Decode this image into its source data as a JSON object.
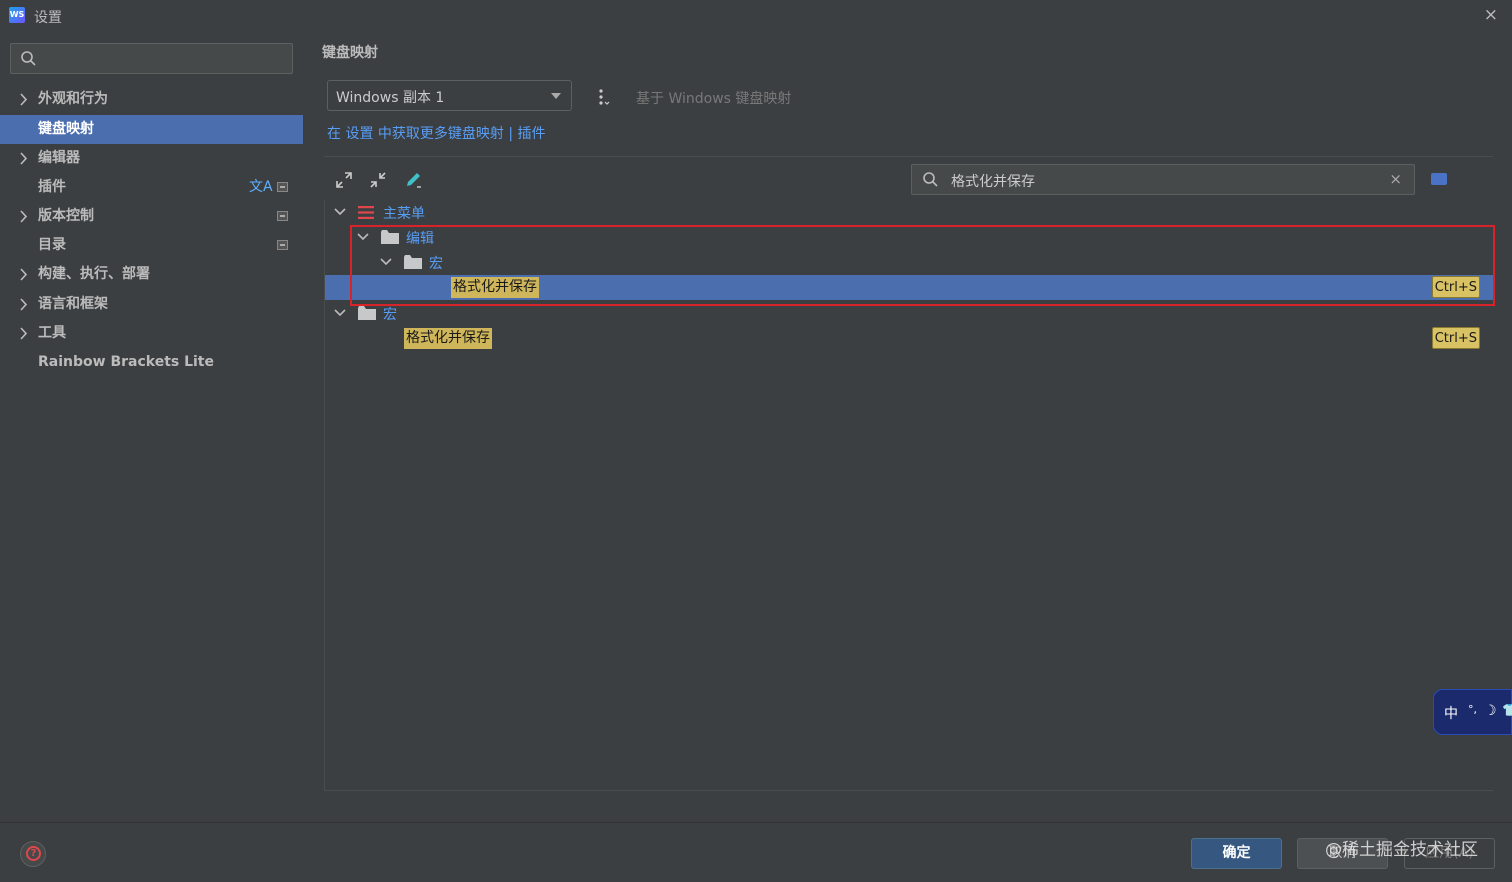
{
  "window": {
    "title": "设置",
    "close_glyph": "×"
  },
  "sidebar": {
    "search_placeholder": "",
    "items": [
      {
        "label": "外观和行为",
        "expandable": true,
        "selected": false
      },
      {
        "label": "键盘映射",
        "expandable": false,
        "selected": true
      },
      {
        "label": "编辑器",
        "expandable": true,
        "selected": false
      },
      {
        "label": "插件",
        "expandable": false,
        "selected": false,
        "lang_icon": "文A"
      },
      {
        "label": "版本控制",
        "expandable": true,
        "selected": false
      },
      {
        "label": "目录",
        "expandable": false,
        "selected": false
      },
      {
        "label": "构建、执行、部署",
        "expandable": true,
        "selected": false
      },
      {
        "label": "语言和框架",
        "expandable": true,
        "selected": false
      },
      {
        "label": "工具",
        "expandable": true,
        "selected": false
      },
      {
        "label": "Rainbow Brackets Lite",
        "expandable": false,
        "selected": false
      }
    ]
  },
  "main": {
    "section_title": "键盘映射",
    "keymap_select": "Windows 副本 1",
    "based_on": "基于 Windows 键盘映射",
    "link_row": "在 设置 中获取更多键盘映射 | 插件",
    "filter": {
      "value": "格式化并保存",
      "clear_glyph": "×"
    },
    "tree": {
      "root": "主菜单",
      "edit_folder": "编辑",
      "macro_sub_folder": "宏",
      "action_selected": "格式化并保存",
      "shortcut_selected": "Ctrl+S",
      "macro_folder": "宏",
      "action_2": "格式化并保存",
      "shortcut_2": "Ctrl+S"
    }
  },
  "ime": {
    "char": "中",
    "sym1": "°,",
    "sym2": "☽",
    "sym3": "👕"
  },
  "footer": {
    "ok": "确定",
    "cancel": "取消",
    "apply": "应用(A)",
    "watermark": "@稀土掘金技术社区"
  },
  "colors": {
    "accent": "#4b6eaf",
    "link": "#589df6",
    "highlight": "#cfb65b",
    "annotation": "#d8232a"
  }
}
